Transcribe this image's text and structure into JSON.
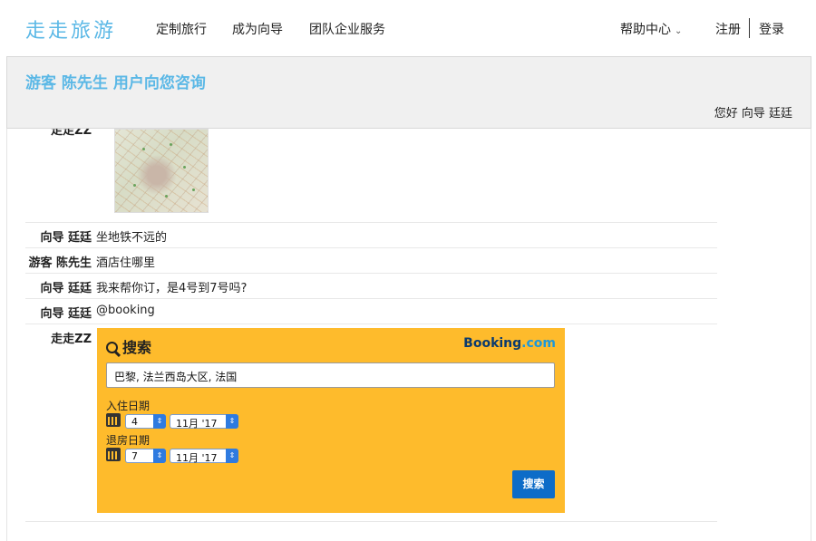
{
  "nav": {
    "logo": "走走旅游",
    "links": [
      "定制旅行",
      "成为向导",
      "团队企业服务"
    ],
    "help": "帮助中心",
    "register": "注册",
    "login": "登录"
  },
  "panel": {
    "title": "游客 陈先生 用户向您咨询",
    "greeting": "您好 向导 廷廷"
  },
  "chat": [
    {
      "sender": "走走ZZ",
      "type": "map"
    },
    {
      "sender": "向导 廷廷",
      "text": "坐地铁不远的"
    },
    {
      "sender": "游客 陈先生",
      "text": "酒店住哪里"
    },
    {
      "sender": "向导 廷廷",
      "text": "我来帮你订，是4号到7号吗?"
    },
    {
      "sender": "向导 廷廷",
      "text": "@booking"
    },
    {
      "sender": "走走ZZ",
      "type": "booking"
    }
  ],
  "booking": {
    "title": "搜索",
    "logo_main": "Booking",
    "logo_suffix": ".com",
    "destination": "巴黎, 法兰西岛大区, 法国",
    "checkin_label": "入住日期",
    "checkin_day": "4",
    "checkin_month": "11月 '17",
    "checkout_label": "退房日期",
    "checkout_day": "7",
    "checkout_month": "11月 '17",
    "search_button": "搜索",
    "colors": {
      "background": "#febb2c",
      "button": "#0d6cc8"
    }
  }
}
